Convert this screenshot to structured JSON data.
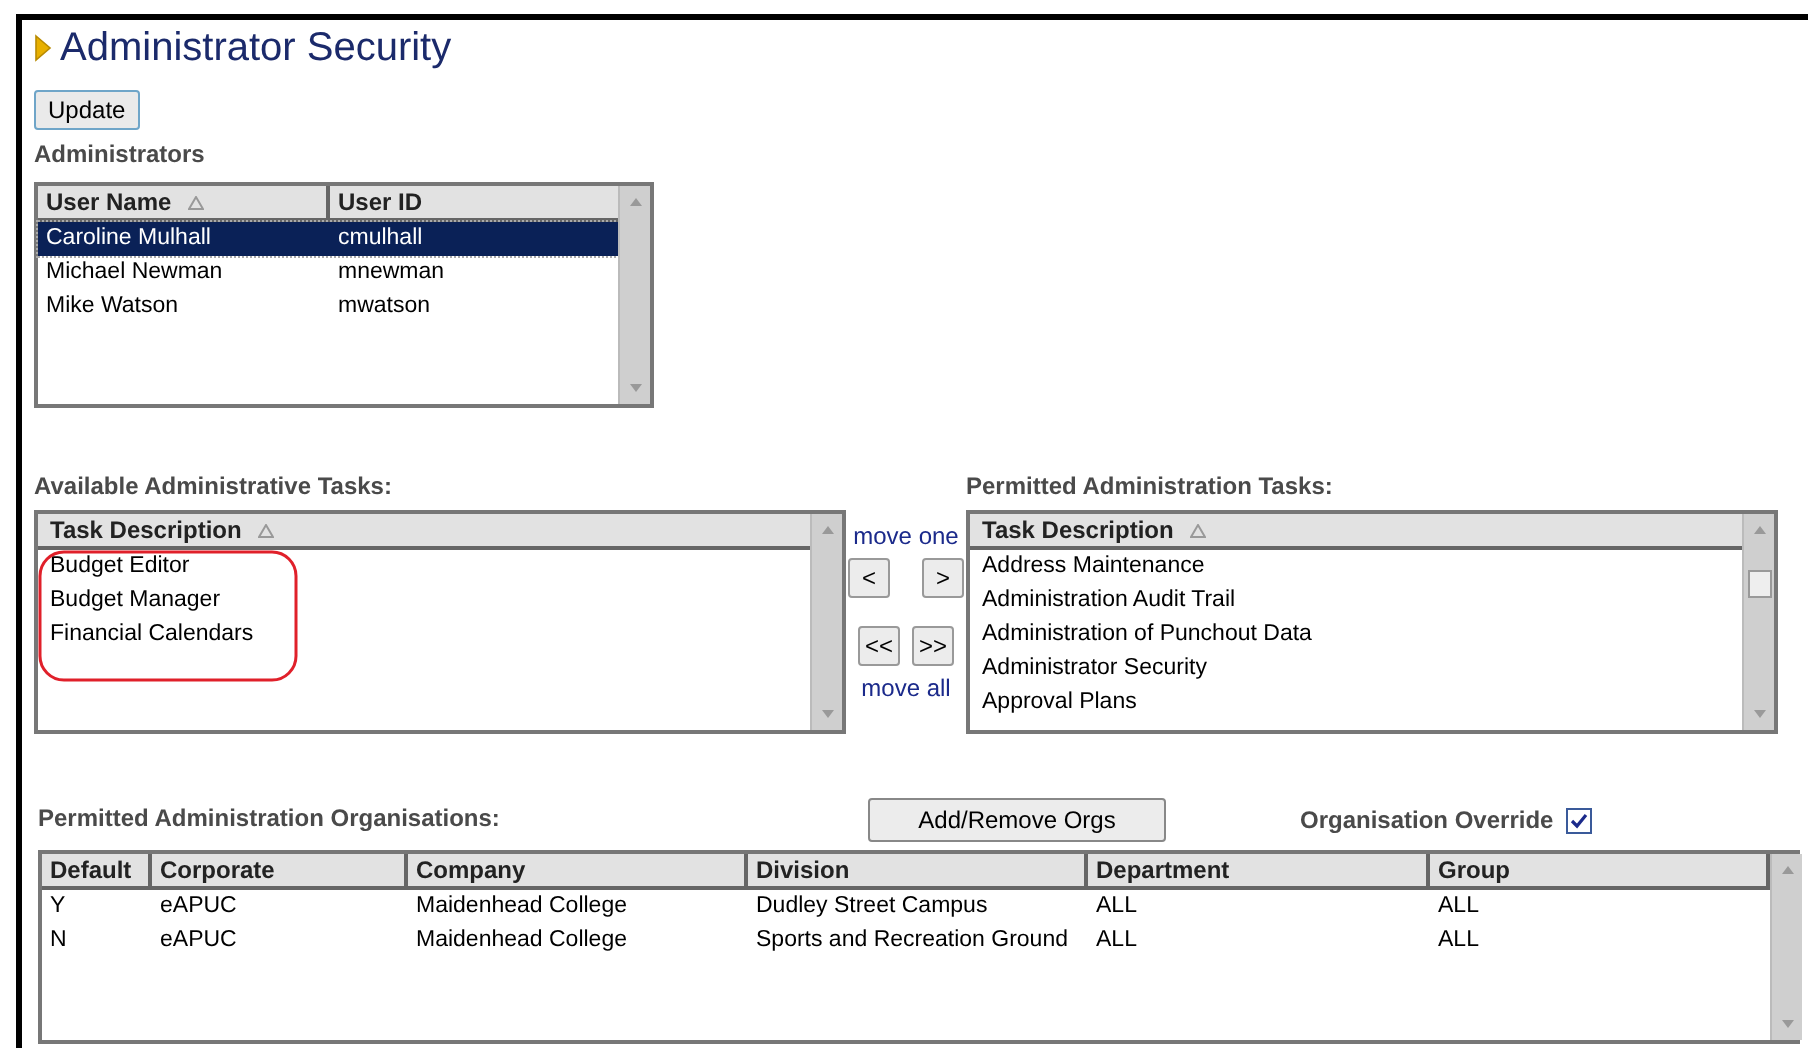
{
  "title": "Administrator Security",
  "update_button": "Update",
  "administrators": {
    "label": "Administrators",
    "columns": [
      "User Name",
      "User ID"
    ],
    "rows": [
      {
        "cells": [
          "Caroline Mulhall",
          "cmulhall"
        ],
        "selected": true
      },
      {
        "cells": [
          "Michael Newman",
          "mnewman"
        ],
        "selected": false
      },
      {
        "cells": [
          "Mike Watson",
          "mwatson"
        ],
        "selected": false
      }
    ]
  },
  "available_tasks": {
    "label": "Available Administrative Tasks:",
    "column": "Task Description",
    "items": [
      "Budget Editor",
      "Budget Manager",
      "Financial Calendars"
    ]
  },
  "move_one": {
    "label": "move one",
    "buttons": [
      "<",
      ">"
    ]
  },
  "move_all": {
    "label": "move all",
    "buttons": [
      "<<",
      ">>"
    ]
  },
  "permitted_tasks": {
    "label": "Permitted Administration Tasks:",
    "column": "Task Description",
    "items": [
      "Address Maintenance",
      "Administration Audit Trail",
      "Administration of Punchout Data",
      "Administrator Security",
      "Approval Plans"
    ]
  },
  "organisations": {
    "label": "Permitted Administration Organisations:",
    "add_remove_button": "Add/Remove Orgs",
    "override": {
      "label": "Organisation Override",
      "checked": true
    },
    "columns": [
      "Default",
      "Corporate",
      "Company",
      "Division",
      "Department",
      "Group"
    ],
    "rows": [
      [
        "Y",
        "eAPUC",
        "Maidenhead College",
        "Dudley Street Campus",
        "ALL",
        "ALL"
      ],
      [
        "N",
        "eAPUC",
        "Maidenhead College",
        "Sports and Recreation Ground",
        "ALL",
        "ALL"
      ]
    ]
  }
}
